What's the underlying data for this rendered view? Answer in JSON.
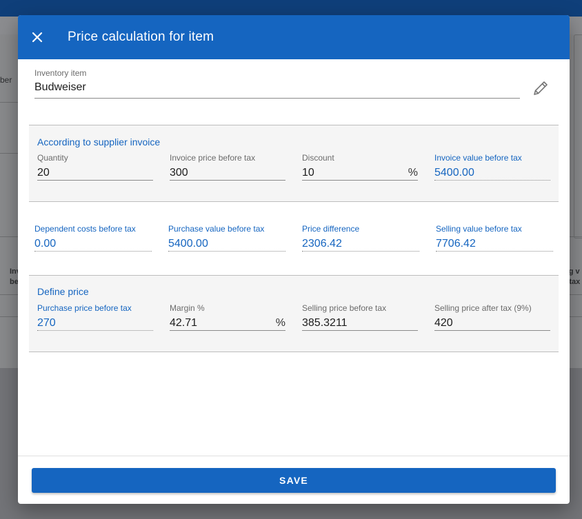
{
  "background": {
    "left_labels": [
      "ber",
      "Inv",
      "be"
    ],
    "right_labels": [
      "ng v",
      "r tax"
    ]
  },
  "dialog": {
    "title": "Price calculation for item",
    "close_icon": "close-icon",
    "inventory": {
      "label": "Inventory item",
      "value": "Budweiser",
      "edit_icon": "pencil-icon"
    },
    "supplier": {
      "title": "According to supplier invoice",
      "quantity": {
        "label": "Quantity",
        "value": "20"
      },
      "invoice_price": {
        "label": "Invoice price before tax",
        "value": "300"
      },
      "discount": {
        "label": "Discount",
        "value": "10",
        "suffix": "%"
      },
      "invoice_value": {
        "label": "Invoice value before tax",
        "value": "5400.00"
      }
    },
    "costs": {
      "dependent_costs": {
        "label": "Dependent costs before tax",
        "value": "0.00"
      },
      "purchase_value": {
        "label": "Purchase value before tax",
        "value": "5400.00"
      },
      "price_difference": {
        "label": "Price difference",
        "value": "2306.42"
      },
      "selling_value": {
        "label": "Selling value before tax",
        "value": "7706.42"
      }
    },
    "define_price": {
      "title": "Define price",
      "purchase_price": {
        "label": "Purchase price before tax",
        "value": "270"
      },
      "margin": {
        "label": "Margin %",
        "value": "42.71",
        "suffix": "%"
      },
      "selling_before": {
        "label": "Selling price before tax",
        "value": "385.3211"
      },
      "selling_after": {
        "label": "Selling price after tax (9%)",
        "value": "420"
      }
    },
    "save_label": "SAVE"
  },
  "colors": {
    "primary": "#1565c0",
    "header_text": "#ffffff"
  }
}
